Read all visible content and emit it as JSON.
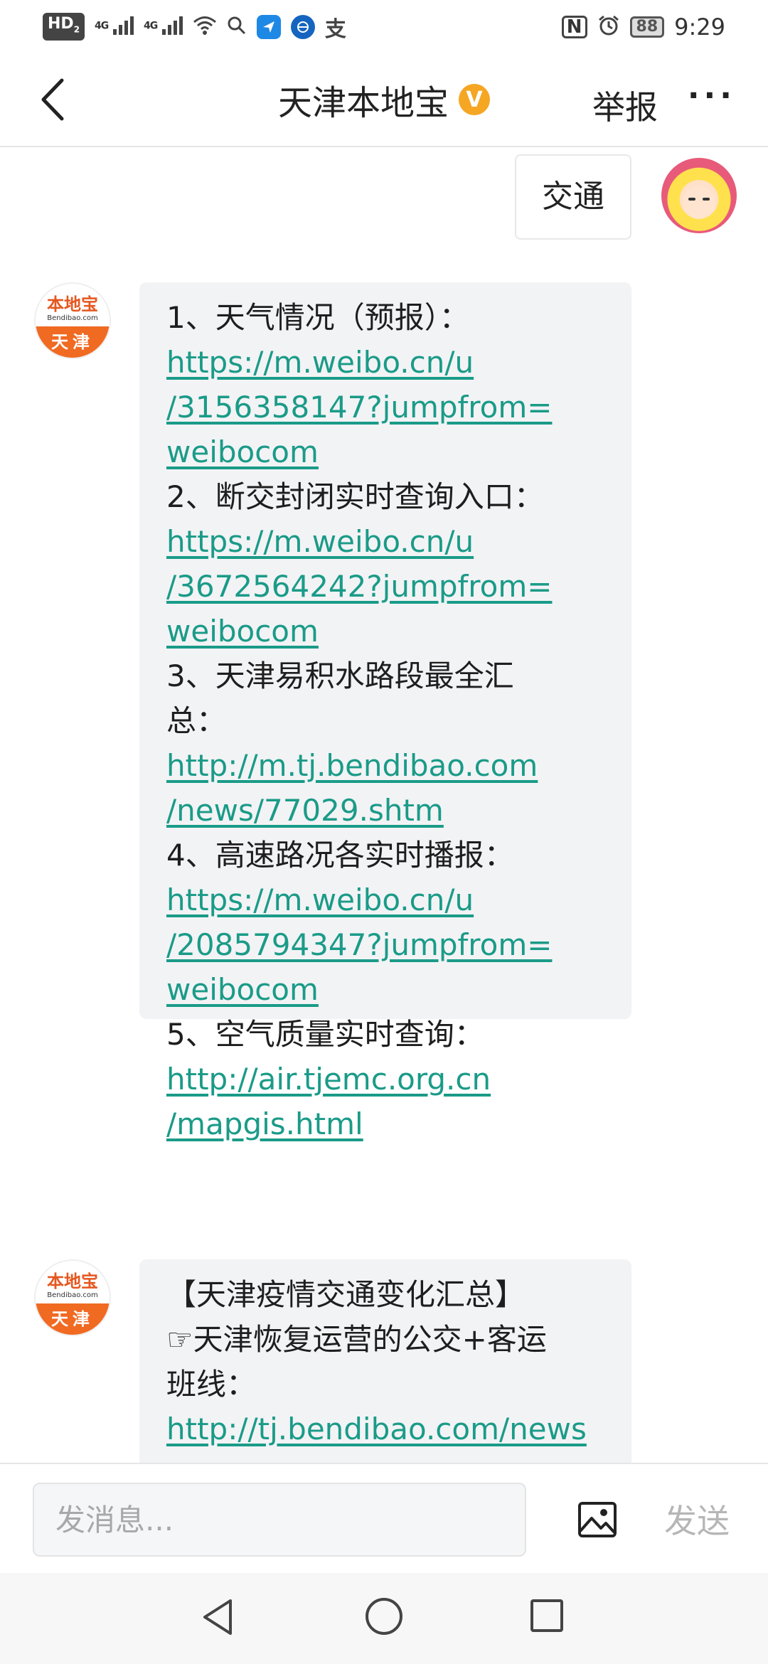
{
  "status_bar": {
    "hd": "HD",
    "hd_sub": "2",
    "sig1": "4G",
    "sig2": "4G",
    "nfc": "N",
    "battery": "88",
    "time": "9:29",
    "alipay_glyph": "支",
    "icons": [
      "hd-icon",
      "signal-icon",
      "signal-icon",
      "wifi-icon",
      "search-icon",
      "app-icon",
      "app-icon",
      "alipay-icon",
      "nfc-icon",
      "alarm-icon",
      "battery-icon"
    ]
  },
  "header": {
    "back_icon": "back-chevron-icon",
    "title": "天津本地宝",
    "verified_badge": "V",
    "report_label": "举报",
    "more_label": "···"
  },
  "messages": {
    "outgoing": {
      "text": "交通"
    },
    "bot_avatar": {
      "top": "本地宝",
      "sub": "Bendibao.com",
      "bottom": "天津"
    },
    "reply1": {
      "l1": "1、天气情况（预报）：",
      "l2": "https://m.weibo.cn/u",
      "l3": "/3156358147?jumpfrom=",
      "l4": "weibocom",
      "l5": "2、断交封闭实时查询入口：",
      "l6": "https://m.weibo.cn/u",
      "l7": "/3672564242?jumpfrom=",
      "l8": "weibocom",
      "l9": "3、天津易积水路段最全汇",
      "l10": "总：",
      "l11": "http://m.tj.bendibao.com",
      "l12": "/news/77029.shtm",
      "l13": "4、高速路况各实时播报：",
      "l14": "https://m.weibo.cn/u",
      "l15": "/2085794347?jumpfrom=",
      "l16": "weibocom",
      "l17": "5、空气质量实时查询：",
      "l18": "http://air.tjemc.org.cn",
      "l19": "/mapgis.html"
    },
    "reply2": {
      "l1": "【天津疫情交通变化汇总】",
      "l2": "☞天津恢复运营的公交+客运",
      "l3": "班线：",
      "l4": "http://tj.bendibao.com/news"
    }
  },
  "input_bar": {
    "placeholder": "发消息...",
    "image_icon": "image-icon",
    "send_label": "发送"
  },
  "nav_bar": {
    "icons": [
      "nav-back-icon",
      "nav-home-icon",
      "nav-recent-icon"
    ]
  },
  "colors": {
    "link": "#1a9b88",
    "bubble_in": "#f2f3f5",
    "verified": "#f5a623",
    "brand_orange": "#f06a22"
  }
}
